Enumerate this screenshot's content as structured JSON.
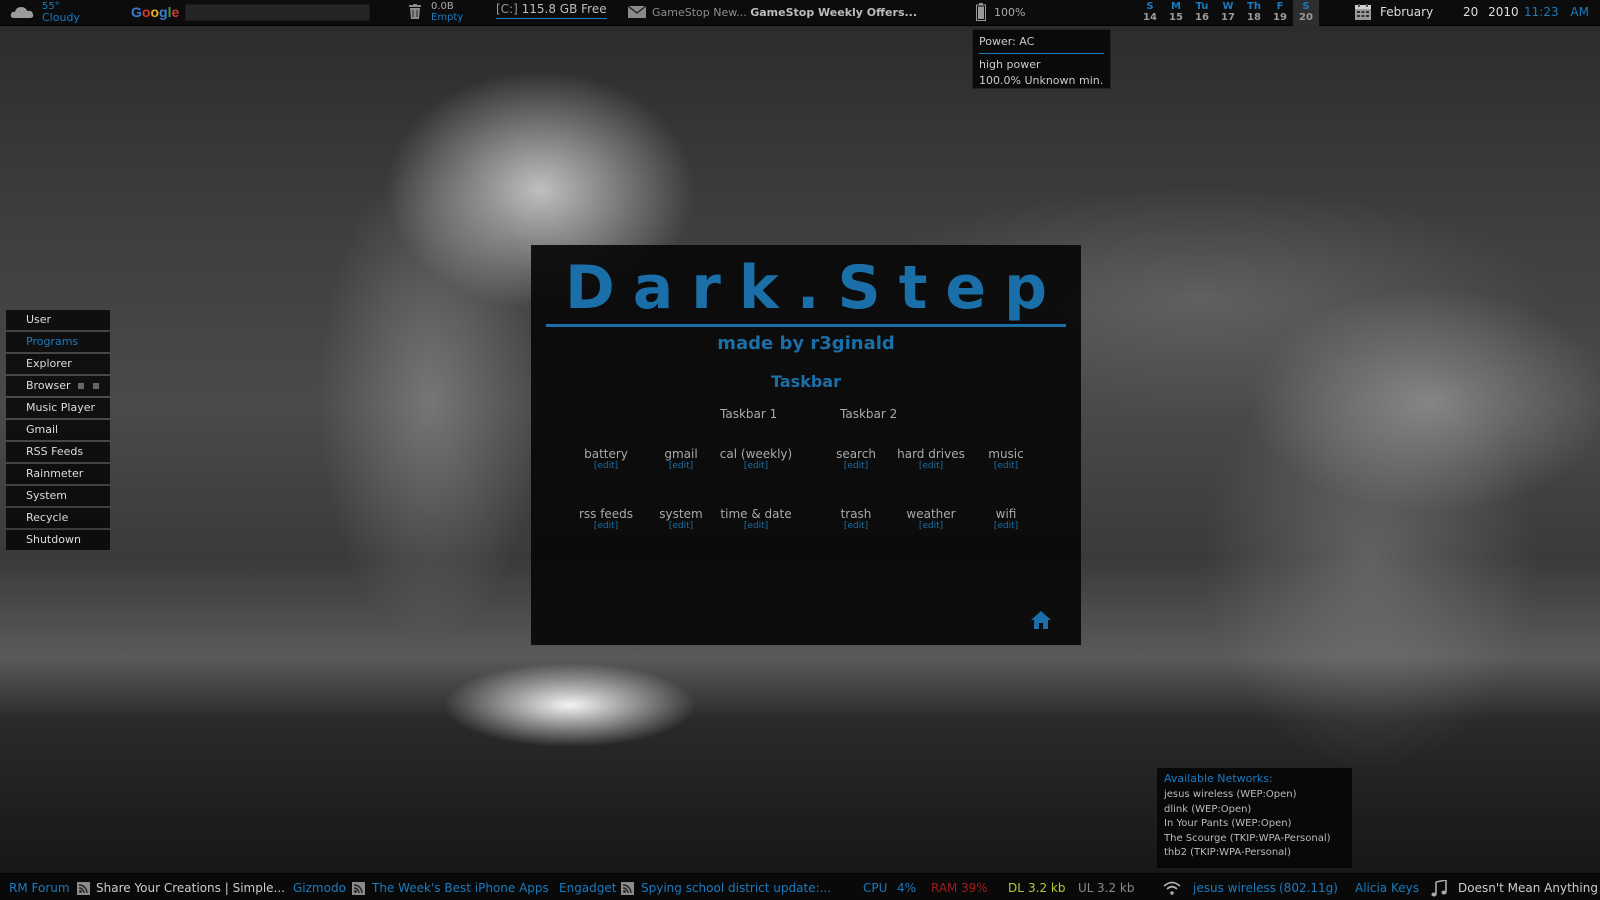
{
  "colors": {
    "accent": "#1b7bbf",
    "panel_blue": "#1b6fa8",
    "ram_red": "#a01d1d",
    "dl_green": "#b5c830"
  },
  "topbar": {
    "weather": {
      "icon": "cloud-icon",
      "temp": "55°",
      "condition": "Cloudy"
    },
    "google": {
      "logo_letters": [
        "G",
        "o",
        "o",
        "g",
        "l",
        "e"
      ],
      "search_value": ""
    },
    "trash": {
      "icon": "trash-icon",
      "size": "0.0B",
      "status": "Empty"
    },
    "drive": {
      "label": "[C:]",
      "free": "115.8 GB Free"
    },
    "mail": {
      "icon": "mail-icon",
      "sender": "GameStop New...",
      "subject": "GameStop Weekly Offers..."
    },
    "battery": {
      "icon": "battery-icon",
      "percent": "100%"
    },
    "calendar": [
      {
        "day": "S",
        "num": "14"
      },
      {
        "day": "M",
        "num": "15"
      },
      {
        "day": "Tu",
        "num": "16"
      },
      {
        "day": "W",
        "num": "17"
      },
      {
        "day": "Th",
        "num": "18"
      },
      {
        "day": "F",
        "num": "19"
      },
      {
        "day": "S",
        "num": "20",
        "today": true
      }
    ],
    "date": {
      "icon": "calendar-icon",
      "month": "February",
      "day": "20",
      "year": "2010"
    },
    "time": {
      "clock": "11:23",
      "ampm": "AM"
    }
  },
  "power_tooltip": {
    "title": "Power: AC",
    "mode": "high power",
    "status": "100.0% Unknown min."
  },
  "left_menu": [
    {
      "label": "User"
    },
    {
      "label": "Programs",
      "active": true
    },
    {
      "label": "Explorer"
    },
    {
      "label": "Browser",
      "squares": true
    },
    {
      "label": "Music Player"
    },
    {
      "label": "Gmail"
    },
    {
      "label": "RSS Feeds"
    },
    {
      "label": "Rainmeter"
    },
    {
      "label": "System"
    },
    {
      "label": "Recycle"
    },
    {
      "label": "Shutdown"
    }
  ],
  "panel": {
    "title": "Dark.Step",
    "subtitle": "made by r3ginald",
    "section": "Taskbar",
    "taskbar1_label": "Taskbar 1",
    "taskbar2_label": "Taskbar 2",
    "edit_label": "[edit]",
    "items_row1": [
      "battery",
      "gmail",
      "cal (weekly)",
      "search",
      "hard drives",
      "music"
    ],
    "items_row2": [
      "rss feeds",
      "system",
      "time & date",
      "trash",
      "weather",
      "wifi"
    ],
    "home_icon": "home-icon"
  },
  "networks": {
    "header": "Available Networks:",
    "list": [
      "jesus wireless (WEP:Open)",
      "dlink (WEP:Open)",
      "In Your Pants (WEP:Open)",
      "The Scourge (TKIP:WPA-Personal)",
      "thb2 (TKIP:WPA-Personal)"
    ]
  },
  "bottombar": {
    "feed1": {
      "source": "RM Forum",
      "headline": "Share Your Creations | Simple..."
    },
    "feed2": {
      "source": "Gizmodo",
      "headline": "The Week's Best iPhone Apps"
    },
    "feed3": {
      "source": "Engadget",
      "headline": "Spying school district update:..."
    },
    "cpu": {
      "label": "CPU",
      "value": "4%"
    },
    "ram": {
      "label": "RAM",
      "value": "39%"
    },
    "dl": {
      "label": "DL",
      "value": "3.2 kb"
    },
    "ul": {
      "label": "UL",
      "value": "3.2 kb"
    },
    "wifi": {
      "icon": "wifi-icon",
      "network": "jesus wireless",
      "speed": "(802.11g)"
    },
    "music": {
      "artist": "Alicia Keys",
      "icon": "music-note-icon",
      "track": "Doesn't Mean Anything"
    }
  }
}
